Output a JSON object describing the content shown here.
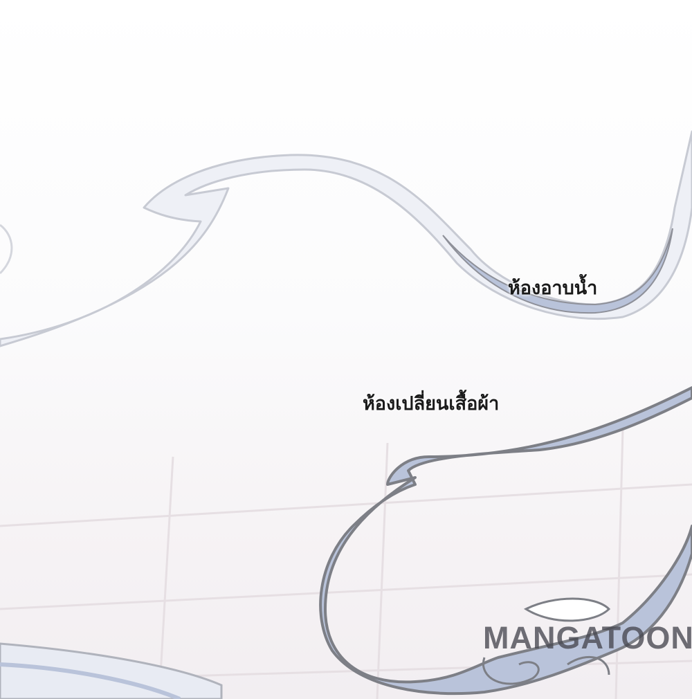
{
  "captions": {
    "bathroom": "ห้องอาบน้ำ",
    "changing_room": "ห้องเปลี่ยนเสื้อผ้า"
  },
  "watermark": {
    "text": "MANGATOON"
  },
  "colors": {
    "background": "#ffffff",
    "ribbon_fill": "#b9c3da",
    "ribbon_outline": "#7d7f86",
    "caption_text": "#1a1a1a",
    "watermark_text": "#4a4a55"
  }
}
